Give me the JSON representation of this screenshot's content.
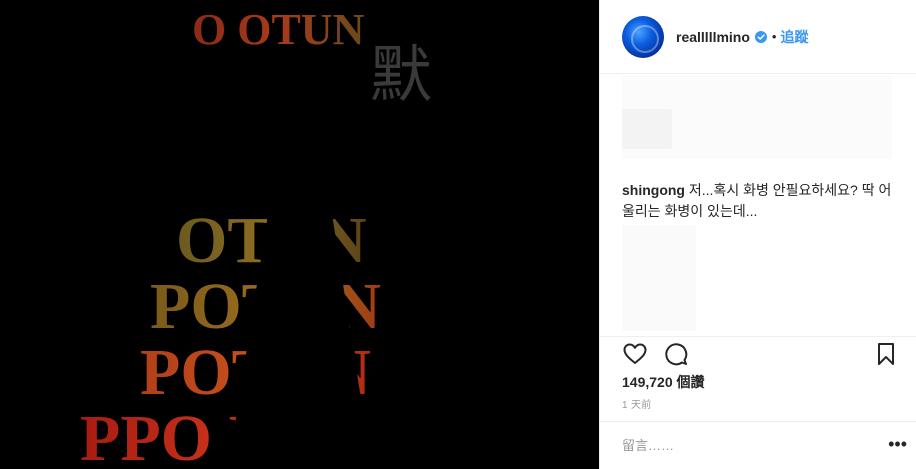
{
  "post": {
    "art_text": {
      "top_line": "O  OTUN",
      "overlay_glyph": "默",
      "row1": "OTUN",
      "row2": "POTUN",
      "row3": "POTUN",
      "row4": "PPO   NIS"
    }
  },
  "header": {
    "username": "realllllmino",
    "follow_label": "追蹤",
    "separator": "•"
  },
  "comment": {
    "user": "shingong",
    "text": " 저...혹시 화병 안필요하세요? 딱 어울리는 화병이 있는데..."
  },
  "stats": {
    "likes_count": "149,720",
    "likes_suffix": " 個讚",
    "time_ago": "1 天前"
  },
  "comment_box": {
    "placeholder": "留言……",
    "more": "•••"
  },
  "colors": {
    "link_blue": "#3897f0",
    "verified_blue": "#3897f0",
    "border": "#efefef"
  }
}
